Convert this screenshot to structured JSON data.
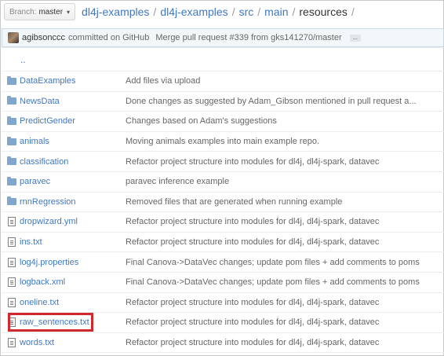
{
  "header": {
    "branch_prefix": "Branch:",
    "branch_name": "master",
    "crumbs": [
      "dl4j-examples",
      "dl4j-examples",
      "src",
      "main",
      "resources"
    ],
    "separator": "/"
  },
  "commit": {
    "author": "agibsonccc",
    "verb": "committed on GitHub",
    "message": "Merge pull request #339 from gks141270/master",
    "more_label": "..."
  },
  "up_label": "..",
  "files": [
    {
      "type": "folder",
      "name": "DataExamples",
      "message": "Add files via upload"
    },
    {
      "type": "folder",
      "name": "NewsData",
      "message": "Done changes as suggested by Adam_Gibson mentioned in pull request a..."
    },
    {
      "type": "folder",
      "name": "PredictGender",
      "message": "Changes based on Adam's suggestions"
    },
    {
      "type": "folder",
      "name": "animals",
      "message": "Moving animals examples into main example repo."
    },
    {
      "type": "folder",
      "name": "classification",
      "message": "Refactor project structure into modules for dl4j, dl4j-spark, datavec"
    },
    {
      "type": "folder",
      "name": "paravec",
      "message": "paravec inference example"
    },
    {
      "type": "folder",
      "name": "rnnRegression",
      "message": "Removed files that are generated when running example"
    },
    {
      "type": "file",
      "name": "dropwizard.yml",
      "message": "Refactor project structure into modules for dl4j, dl4j-spark, datavec"
    },
    {
      "type": "file",
      "name": "ins.txt",
      "message": "Refactor project structure into modules for dl4j, dl4j-spark, datavec"
    },
    {
      "type": "file",
      "name": "log4j.properties",
      "message": "Final Canova->DataVec changes; update pom files + add comments to poms"
    },
    {
      "type": "file",
      "name": "logback.xml",
      "message": "Final Canova->DataVec changes; update pom files + add comments to poms"
    },
    {
      "type": "file",
      "name": "oneline.txt",
      "message": "Refactor project structure into modules for dl4j, dl4j-spark, datavec"
    },
    {
      "type": "file",
      "name": "raw_sentences.txt",
      "message": "Refactor project structure into modules for dl4j, dl4j-spark, datavec",
      "highlighted": true
    },
    {
      "type": "file",
      "name": "words.txt",
      "message": "Refactor project structure into modules for dl4j, dl4j-spark, datavec"
    }
  ],
  "colors": {
    "link": "#4078c0",
    "highlight": "#d0282c",
    "commit_bar_bg": "#f2f8fa"
  }
}
